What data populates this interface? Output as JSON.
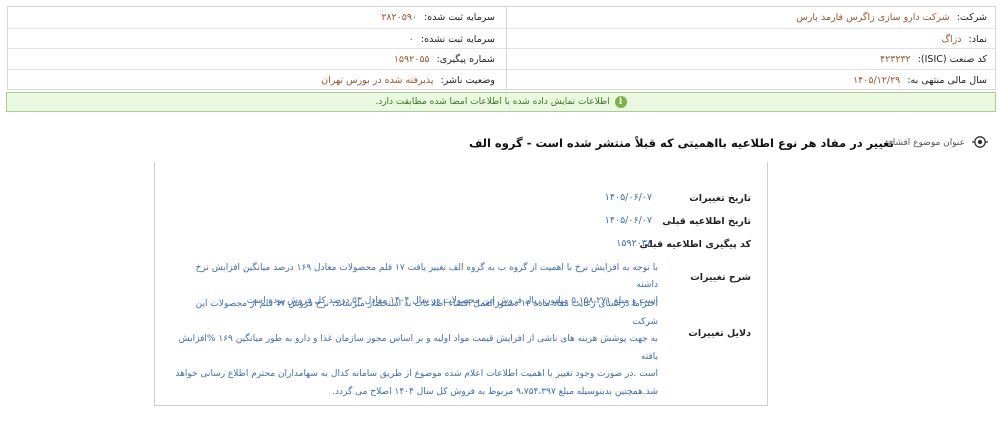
{
  "company": {
    "label": "شرکت:",
    "value": "شرکت دارو سازی زاگرس فارمد پارس"
  },
  "symbol": {
    "label": "نماد:",
    "value": "دزاگ"
  },
  "isic": {
    "label": "کد صنعت (ISIC):",
    "value": "۴۲۳۲۳۲"
  },
  "fiscal_year": {
    "label": "سال مالی منتهی به:",
    "value": "۱۴۰۵/۱۲/۲۹"
  },
  "registered_capital": {
    "label": "سرمایه ثبت شده:",
    "value": "۲۸۲۰۵۹۰"
  },
  "unregistered_capital": {
    "label": "سرمایه ثبت نشده:",
    "value": "۰"
  },
  "tracking_number": {
    "label": "شماره پیگیری:",
    "value": "۱۵۹۲۰۵۵"
  },
  "publisher_status": {
    "label": "وضعیت ناشر:",
    "value": "پذیرفته شده در بورس تهران"
  },
  "notice": {
    "icon": "info-icon",
    "text": "اطلاعات نمایش داده شده با اطلاعات امضا شده مطابقت دارد.",
    "color": "#7cb443"
  },
  "subject": {
    "label": "عنوان موضوع افشاء:",
    "text": "تغییر در مفاد هر نوع اطلاعیه بااهمیتی که قبلاً منتشر شده است - گروه الف"
  },
  "details": {
    "change_date": {
      "label": "تاریخ تغییرات",
      "value": "۱۴۰۵/۰۶/۰۷"
    },
    "prev_notice_date": {
      "label": "تاریخ اطلاعیه قبلی",
      "value": "۱۴۰۵/۰۶/۰۷"
    },
    "prev_tracking_code": {
      "label": "کد پیگیری اطلاعیه قبلی",
      "value": "۱۵۹۲۰۳۸"
    },
    "change_description": {
      "label": "شرح تغییرات",
      "lines": [
        "با توجه به افزایش نرخ با اهمیت از گروه ب به گروه الف تغییر یافت ۱۷ قلم محصولات معادل ۱۶۹ درصد میانگین افزایش نرخ داشته",
        "است و مبلغ ۵،۱۵۸،۲۷۱ میلیون ریال فروش این محصولات در سال ۱۴۰۴ معادل ۵۳ درصد کل فروش بوده است"
      ]
    },
    "change_reasons": {
      "label": "دلایل تغییرات",
      "lines": [
        "احتراما دراستای رعایت مفاد ماده ۱۳ دستورالعمل افشاء اطلاعات به استحضار میرساند، نرخ فروش ۱۷ قلم از محصولات این شرکت",
        "به جهت پوشش هزینه های ناشی از افزایش قیمت مواد اولیه و بر اساس مجوز سازمان غذا و دارو به طور میانگین ۱۶۹ %افزایش یافته",
        "است .در صورت وجود تغییر با اهمیت اطلاعات اعلام شده موضوع از طریق سامانه کدال به سهامداران محترم اطلاع رسانی خواهد",
        "شد.همچنین بدینوسیله مبلغ ۹،۷۵۴،۳۹۷ مربوط به فروش کل سال ۱۴۰۴ اصلاح می گردد."
      ]
    }
  }
}
